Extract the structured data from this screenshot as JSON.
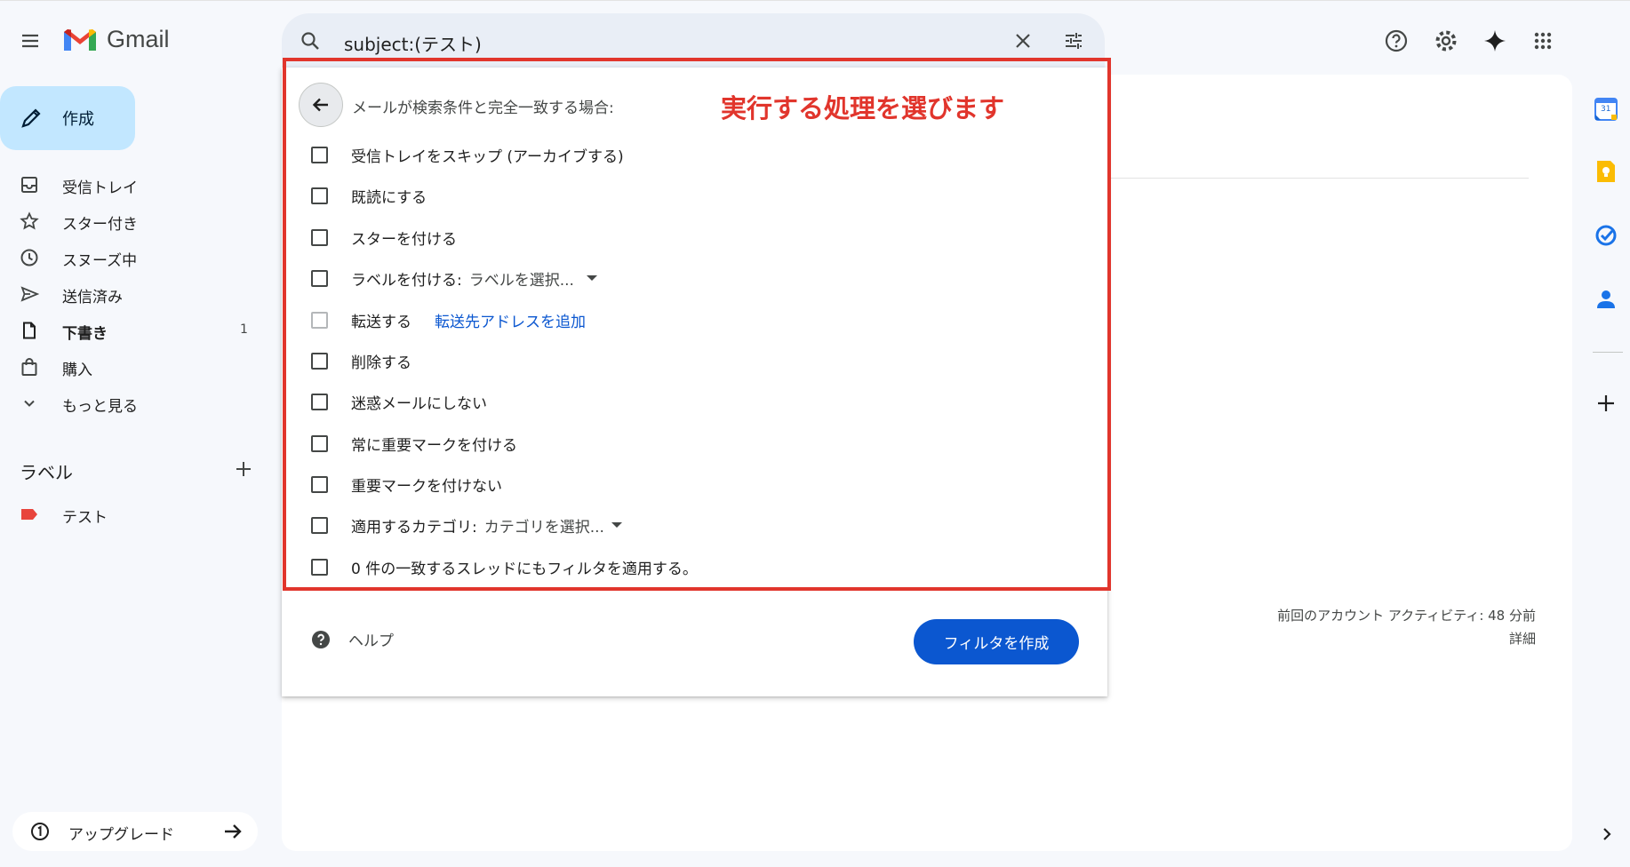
{
  "app": {
    "name": "Gmail",
    "colors": {
      "accent": "#0b57d0",
      "compose_bg": "#c2e7ff",
      "annotation": "#e1352c",
      "label_test": "#e8453c"
    }
  },
  "topbar": {
    "menu_icon": "hamburger-menu-icon",
    "logo_text": "Gmail",
    "search": {
      "query": "subject:(テスト)",
      "icon": "search-icon"
    },
    "right_icons": [
      "help-icon",
      "settings-icon",
      "gemini-sparkle-icon",
      "apps-grid-icon"
    ]
  },
  "sidebar": {
    "compose_label": "作成",
    "items": [
      {
        "label": "受信トレイ",
        "icon": "inbox-icon",
        "count": ""
      },
      {
        "label": "スター付き",
        "icon": "star-icon",
        "count": ""
      },
      {
        "label": "スヌーズ中",
        "icon": "clock-icon",
        "count": ""
      },
      {
        "label": "送信済み",
        "icon": "send-icon",
        "count": ""
      },
      {
        "label": "下書き",
        "icon": "draft-icon",
        "count": "1"
      },
      {
        "label": "購入",
        "icon": "shopping-bag-icon",
        "count": ""
      },
      {
        "label": "もっと見る",
        "icon": "chevron-down-icon",
        "count": ""
      }
    ],
    "labels_heading": "ラベル",
    "labels": [
      {
        "name": "テスト",
        "color": "#e8453c"
      }
    ],
    "upgrade": {
      "label": "アップグレード",
      "step": "1"
    }
  },
  "filter": {
    "header": "メールが検索条件と完全一致する場合:",
    "annotation": "実行する処理を選びます",
    "options": [
      {
        "label": "受信トレイをスキップ (アーカイブする)",
        "checked": false
      },
      {
        "label": "既読にする",
        "checked": false
      },
      {
        "label": "スターを付ける",
        "checked": false
      },
      {
        "label": "ラベルを付ける:",
        "select": "ラベルを選択...",
        "checked": false
      },
      {
        "label": "転送する",
        "link": "転送先アドレスを追加",
        "checked": false,
        "disabled": true
      },
      {
        "label": "削除する",
        "checked": false
      },
      {
        "label": "迷惑メールにしない",
        "checked": false
      },
      {
        "label": "常に重要マークを付ける",
        "checked": false
      },
      {
        "label": "重要マークを付けない",
        "checked": false
      },
      {
        "label": "適用するカテゴリ:",
        "select": "カテゴリを選択...",
        "checked": false
      },
      {
        "label": "0 件の一致するスレッドにもフィルタを適用する。",
        "checked": false
      }
    ],
    "help_label": "ヘルプ",
    "create_button": "フィルタを作成"
  },
  "footer": {
    "activity_line": "前回のアカウント アクティビティ: 48 分前",
    "details_link": "詳細"
  },
  "right_rail": {
    "icons": [
      "calendar-icon",
      "keep-icon",
      "tasks-icon",
      "contacts-icon",
      "add-icon",
      "chevron-right-icon"
    ],
    "calendar_day": "31"
  }
}
